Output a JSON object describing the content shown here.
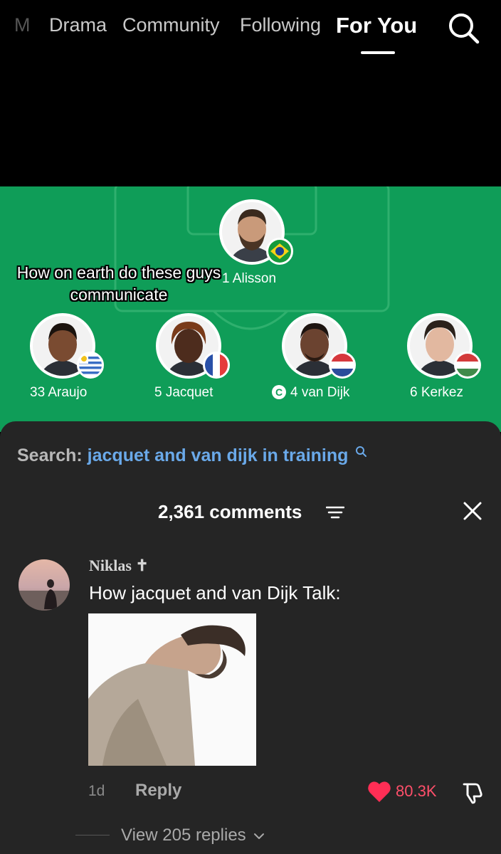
{
  "nav": {
    "tabs": [
      {
        "label": "M"
      },
      {
        "label": "Drama"
      },
      {
        "label": "Community"
      },
      {
        "label": "Following"
      },
      {
        "label": "For You"
      }
    ],
    "search_icon": "search-icon"
  },
  "lineup": {
    "caption": "How on earth do these guys communicate",
    "players": [
      {
        "label": "1 Alisson",
        "flag": "brazil"
      },
      {
        "label": "33 Araujo",
        "flag": "uruguay"
      },
      {
        "label": "5 Jacquet",
        "flag": "france"
      },
      {
        "label": "4 van Dijk",
        "flag": "netherlands",
        "captain_badge": "C"
      },
      {
        "label": "6 Kerkez",
        "flag": "hungary"
      }
    ],
    "colors": {
      "pitch": "#0f9d58"
    }
  },
  "panel": {
    "search_label": "Search:",
    "search_query": "jacquet and van dijk in training",
    "comments_count": "2,361 comments",
    "sort_icon": "sort-icon",
    "close_icon": "close-icon"
  },
  "comment": {
    "user": "Niklas ✝",
    "text": "How jacquet and van Dijk Talk:",
    "time": "1d",
    "reply_label": "Reply",
    "likes": "80.3K",
    "like_icon": "heart-icon",
    "dislike_icon": "thumbs-down-icon",
    "view_replies": "View 205 replies",
    "colors": {
      "like": "#ff4f6a"
    }
  }
}
